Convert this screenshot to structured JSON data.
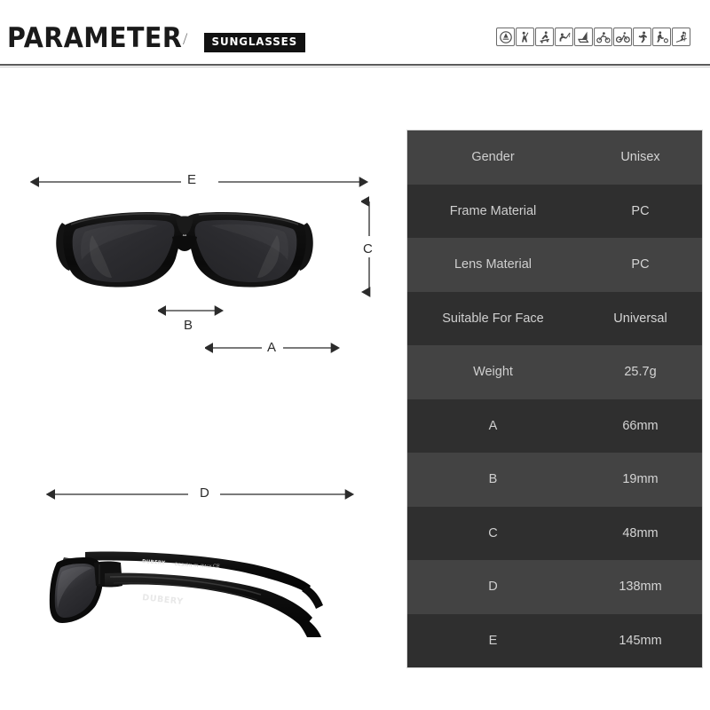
{
  "header": {
    "title": "PARAMETER",
    "separator": "/",
    "badge": "SUNGLASSES",
    "sport_icons": [
      "golf-icon",
      "baseball-icon",
      "skateboard-icon",
      "fishing-icon",
      "sailing-icon",
      "motocross-icon",
      "cycling-icon",
      "running-icon",
      "soccer-icon",
      "skiing-icon"
    ]
  },
  "diagram": {
    "front_view": {
      "label_e": "E",
      "label_c": "C",
      "label_b": "B",
      "label_a": "A"
    },
    "side_view": {
      "label_d": "D",
      "brand_text": "DUBERY",
      "temple_text": "DESIGN IN ITALY",
      "ce_mark": "CE"
    }
  },
  "spec_table": {
    "rows": [
      {
        "key": "Gender",
        "value": "Unisex"
      },
      {
        "key": "Frame Material",
        "value": "PC"
      },
      {
        "key": "Lens Material",
        "value": "PC"
      },
      {
        "key": "Suitable For Face",
        "value": "Universal"
      },
      {
        "key": "Weight",
        "value": "25.7g"
      },
      {
        "key": "A",
        "value": "66mm"
      },
      {
        "key": "B",
        "value": "19mm"
      },
      {
        "key": "C",
        "value": "48mm"
      },
      {
        "key": "D",
        "value": "138mm"
      },
      {
        "key": "E",
        "value": "145mm"
      }
    ]
  },
  "colors": {
    "page_background": "#ffffff",
    "header_text": "#1a1a1a",
    "badge_background": "#111111",
    "badge_text": "#ffffff",
    "row_light": "#434343",
    "row_dark": "#2f2f2f",
    "row_text": "#cfcfcf",
    "arrow": "#2b2b2b",
    "frame": "#0d0d0d",
    "lens": "#262629"
  }
}
